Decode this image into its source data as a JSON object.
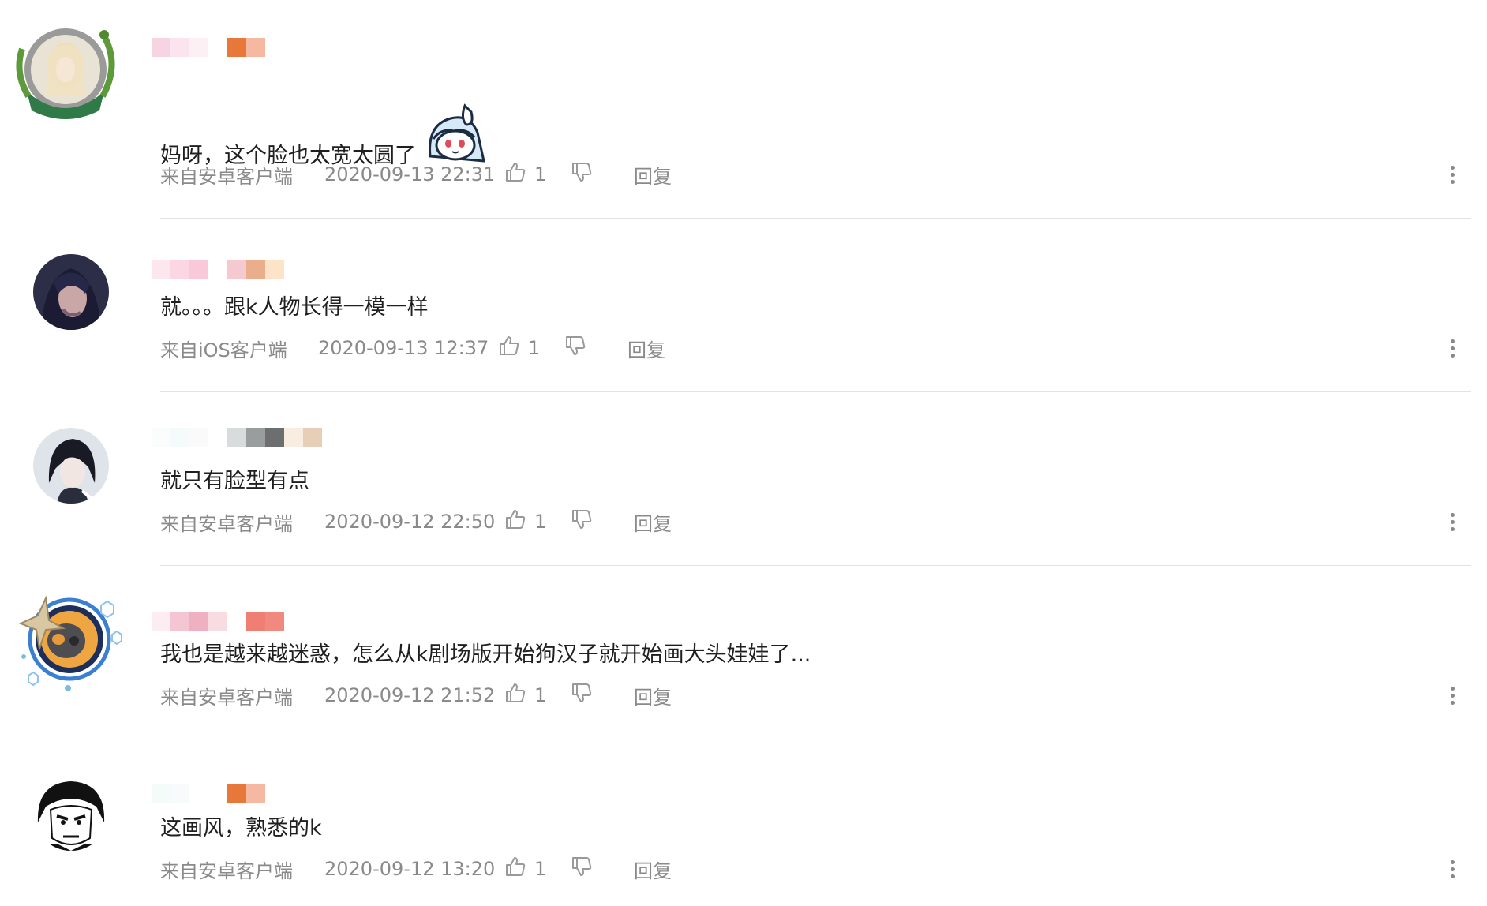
{
  "labels": {
    "reply": "回复"
  },
  "colors": {
    "meta_text": "#8a8a8a",
    "divider": "#e3e3e3",
    "icon": "#999999"
  },
  "comments": [
    {
      "text": "妈呀，这个脸也太宽太圆了",
      "has_sticker": true,
      "sticker_icon": "anime-girl-sticker-icon",
      "source": "来自安卓客户端",
      "time": "2020-09-13 22:31",
      "likes": "1",
      "avatar_icon": "slytherin-badge-avatar"
    },
    {
      "text": "就。。。跟k人物长得一模一样",
      "source": "来自iOS客户端",
      "time": "2020-09-13 12:37",
      "likes": "1",
      "avatar_icon": "dark-hair-character-avatar"
    },
    {
      "text": "就只有脸型有点",
      "source": "来自安卓客户端",
      "time": "2020-09-12 22:50",
      "likes": "1",
      "avatar_icon": "black-hair-character-avatar"
    },
    {
      "text": "我也是越来越迷惑，怎么从k剧场版开始狗汉子就开始画大头娃娃了...",
      "source": "来自安卓客户端",
      "time": "2020-09-12 21:52",
      "likes": "1",
      "avatar_icon": "robot-badge-avatar"
    },
    {
      "text": "这画风，熟悉的k",
      "source": "来自安卓客户端",
      "time": "2020-09-12 13:20",
      "likes": "1",
      "avatar_icon": "manga-face-avatar"
    }
  ]
}
